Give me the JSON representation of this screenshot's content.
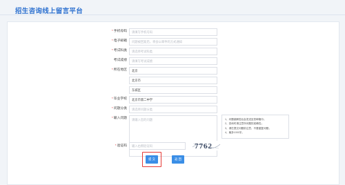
{
  "page": {
    "title": "招生咨询线上留言平台"
  },
  "form": {
    "fields": [
      {
        "label": "手机号码",
        "required": true,
        "value": "",
        "placeholder": "请填写手机号码"
      },
      {
        "label": "电子邮箱",
        "required": true,
        "value": "",
        "placeholder": "问题被回复后，将会以邮件的方式通知"
      },
      {
        "label": "考试科类",
        "required": true,
        "value": "",
        "placeholder": "请选择考试科类"
      },
      {
        "label": "考试成绩",
        "required": false,
        "value": "",
        "placeholder": "请填写考试成绩"
      },
      {
        "label": "所在地区",
        "required": true,
        "value": "北京",
        "placeholder": ""
      },
      {
        "label": "",
        "required": false,
        "value": "北京市",
        "placeholder": ""
      },
      {
        "label": "",
        "required": false,
        "value": "东城区",
        "placeholder": ""
      },
      {
        "label": "毕业学校",
        "required": true,
        "value": "北京市第二中学",
        "placeholder": ""
      },
      {
        "label": "问题分类",
        "required": true,
        "value": "",
        "placeholder": "请选择问题分类"
      }
    ],
    "question": {
      "label": "输入问题",
      "required": true,
      "placeholder": "请输入您的问题"
    },
    "tips": [
      "1、问题被解答后会发送至您邮箱中；",
      "2、查询时请注意所问题的准确性；",
      "3、请在提交问题前注意，不要重复问题；",
      "4、最多1000字。"
    ],
    "captcha": {
      "label": "验证码",
      "required": true,
      "placeholder": "输入右侧验证码",
      "image_text": "7762"
    },
    "buttons": {
      "submit": "提 交",
      "back": "返 回"
    }
  },
  "colors": {
    "accent": "#3a8ee6",
    "title": "#2b6fcf",
    "required": "#e23a3a",
    "highlight": "#e53935"
  }
}
